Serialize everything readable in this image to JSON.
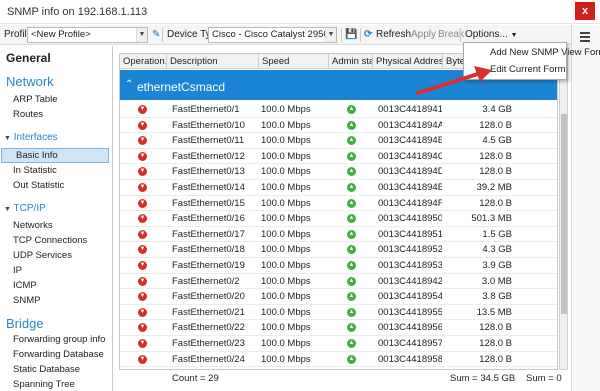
{
  "window": {
    "title": "SNMP info on 192.168.1.113",
    "close_label": "x"
  },
  "toolbar": {
    "profile_label": "Profile:",
    "profile_value": "<New Profile>",
    "device_type_label": "Device Type:",
    "device_type_value": "Cisco - Cisco Catalyst 2950T-24 (aut",
    "refresh_label": "Refresh",
    "apply_label": "Apply",
    "break_label": "Break",
    "options_label": "Options..."
  },
  "options_menu": {
    "items": [
      "Add New SNMP View Form",
      "Edit Current Form"
    ]
  },
  "sidebar": {
    "general": "General",
    "network_heading": "Network",
    "network_items": [
      "ARP Table",
      "Routes"
    ],
    "interfaces_heading": "Interfaces",
    "interfaces_items": [
      "Basic Info",
      "In Statistic",
      "Out Statistic"
    ],
    "selected": "Basic Info",
    "tcpip_heading": "TCP/IP",
    "tcpip_items": [
      "Networks",
      "TCP Connections",
      "UDP Services",
      "IP",
      "ICMP",
      "SNMP"
    ],
    "bridge_heading": "Bridge",
    "bridge_items": [
      "Forwarding group info",
      "Forwarding Database",
      "Static Database",
      "Spanning Tree"
    ]
  },
  "table": {
    "columns": [
      "Operation...",
      "Description",
      "Speed",
      "Admin stat...",
      "Physical Address",
      "Bytes"
    ],
    "group_label": "ethernetCsmacd",
    "rows": [
      {
        "oper": "down",
        "desc": "FastEthernet0/1",
        "speed": "100.0 Mbps",
        "admin": "up",
        "mac": "0013C4418941",
        "bytes": "3.4 GB"
      },
      {
        "oper": "down",
        "desc": "FastEthernet0/10",
        "speed": "100.0 Mbps",
        "admin": "up",
        "mac": "0013C441894A",
        "bytes": "128.0 B"
      },
      {
        "oper": "down",
        "desc": "FastEthernet0/11",
        "speed": "100.0 Mbps",
        "admin": "up",
        "mac": "0013C441894B",
        "bytes": "4.5 GB"
      },
      {
        "oper": "down",
        "desc": "FastEthernet0/12",
        "speed": "100.0 Mbps",
        "admin": "up",
        "mac": "0013C441894C",
        "bytes": "128.0 B"
      },
      {
        "oper": "down",
        "desc": "FastEthernet0/13",
        "speed": "100.0 Mbps",
        "admin": "up",
        "mac": "0013C441894D",
        "bytes": "128.0 B"
      },
      {
        "oper": "down",
        "desc": "FastEthernet0/14",
        "speed": "100.0 Mbps",
        "admin": "up",
        "mac": "0013C441894E",
        "bytes": "39.2 MB"
      },
      {
        "oper": "down",
        "desc": "FastEthernet0/15",
        "speed": "100.0 Mbps",
        "admin": "up",
        "mac": "0013C441894F",
        "bytes": "128.0 B"
      },
      {
        "oper": "down",
        "desc": "FastEthernet0/16",
        "speed": "100.0 Mbps",
        "admin": "up",
        "mac": "0013C4418950",
        "bytes": "501.3 MB"
      },
      {
        "oper": "down",
        "desc": "FastEthernet0/17",
        "speed": "100.0 Mbps",
        "admin": "up",
        "mac": "0013C4418951",
        "bytes": "1.5 GB"
      },
      {
        "oper": "down",
        "desc": "FastEthernet0/18",
        "speed": "100.0 Mbps",
        "admin": "up",
        "mac": "0013C4418952",
        "bytes": "4.3 GB"
      },
      {
        "oper": "down",
        "desc": "FastEthernet0/19",
        "speed": "100.0 Mbps",
        "admin": "up",
        "mac": "0013C4418953",
        "bytes": "3.9 GB"
      },
      {
        "oper": "down",
        "desc": "FastEthernet0/2",
        "speed": "100.0 Mbps",
        "admin": "up",
        "mac": "0013C4418942",
        "bytes": "3.0 MB"
      },
      {
        "oper": "down",
        "desc": "FastEthernet0/20",
        "speed": "100.0 Mbps",
        "admin": "up",
        "mac": "0013C4418954",
        "bytes": "3.8 GB"
      },
      {
        "oper": "down",
        "desc": "FastEthernet0/21",
        "speed": "100.0 Mbps",
        "admin": "up",
        "mac": "0013C4418955",
        "bytes": "13.5 MB"
      },
      {
        "oper": "down",
        "desc": "FastEthernet0/22",
        "speed": "100.0 Mbps",
        "admin": "up",
        "mac": "0013C4418956",
        "bytes": "128.0 B"
      },
      {
        "oper": "down",
        "desc": "FastEthernet0/23",
        "speed": "100.0 Mbps",
        "admin": "up",
        "mac": "0013C4418957",
        "bytes": "128.0 B"
      },
      {
        "oper": "down",
        "desc": "FastEthernet0/24",
        "speed": "100.0 Mbps",
        "admin": "up",
        "mac": "0013C4418958",
        "bytes": "128.0 B"
      }
    ]
  },
  "status": {
    "count": "Count = 29",
    "sum_bytes": "Sum = 34.5 GB",
    "sum_other": "Sum = 0"
  },
  "colors": {
    "accent": "#1c84d4",
    "up": "#3fae44",
    "down": "#d62d2d",
    "arrow": "#d9302c"
  }
}
